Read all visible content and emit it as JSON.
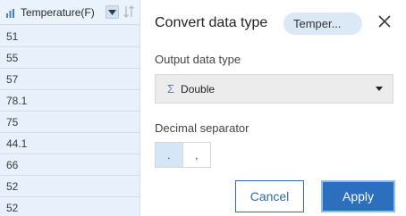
{
  "column": {
    "header": "Temperature(F)",
    "header_icon": "bar-chart-icon",
    "dropdown_icon": "chevron-down-icon",
    "sort_icon": "sort-icon",
    "rows": [
      "51",
      "55",
      "57",
      "78.1",
      "75",
      "44.1",
      "66",
      "52",
      "52"
    ]
  },
  "panel": {
    "title": "Convert data type",
    "field_pill": "Temper...",
    "close_icon": "close-icon",
    "output_label": "Output data type",
    "output_value": "Double",
    "output_icon": "sigma-icon",
    "decimal_label": "Decimal separator",
    "decimal_options": [
      ".",
      ","
    ],
    "decimal_selected": ".",
    "cancel_label": "Cancel",
    "apply_label": "Apply"
  },
  "colors": {
    "accent": "#2c6fbf",
    "column_bg": "#e8f1fb",
    "pill_bg": "#dbe9f7"
  }
}
